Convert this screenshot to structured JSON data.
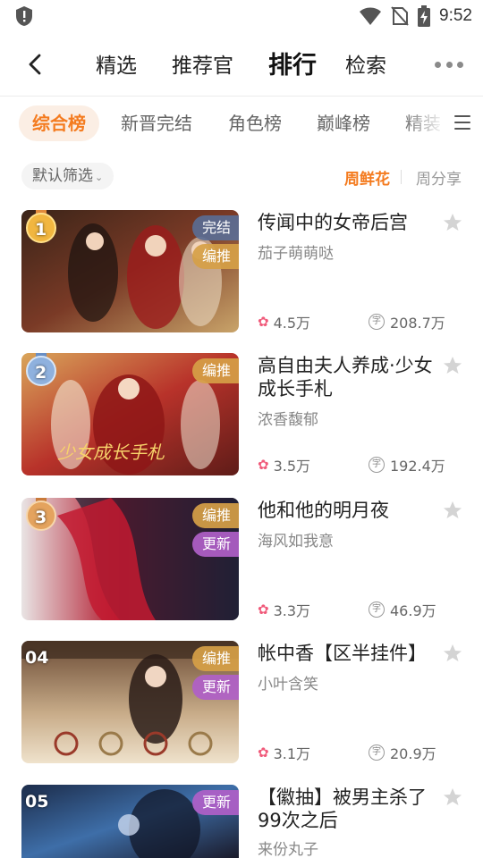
{
  "status_bar": {
    "time": "9:52",
    "icons": [
      "shield-alert-icon",
      "wifi-icon",
      "no-sim-icon",
      "battery-charging-icon"
    ]
  },
  "nav": {
    "tabs": [
      {
        "label": "精选",
        "active": false
      },
      {
        "label": "推荐官",
        "active": false
      },
      {
        "label": "排行",
        "active": true
      },
      {
        "label": "检索",
        "active": false
      }
    ],
    "back_icon": "chevron-left-icon",
    "more_icon": "more-dots-icon"
  },
  "categories": [
    {
      "label": "综合榜",
      "active": true
    },
    {
      "label": "新晋完结",
      "active": false
    },
    {
      "label": "角色榜",
      "active": false
    },
    {
      "label": "巅峰榜",
      "active": false
    },
    {
      "label": "精装",
      "active": false
    }
  ],
  "filter": {
    "label": "默认筛选",
    "sort_active": "周鲜花",
    "sort_other": "周分享"
  },
  "books": [
    {
      "rank": "1",
      "title": "传闻中的女帝后宫",
      "author": "茄子萌萌哒",
      "flowers": "4.5万",
      "words": "208.7万",
      "badges": [
        "完结",
        "编推"
      ]
    },
    {
      "rank": "2",
      "title": "高自由夫人养成·少女成长手札",
      "author": "浓香馥郁",
      "flowers": "3.5万",
      "words": "192.4万",
      "badges": [
        "编推"
      ]
    },
    {
      "rank": "3",
      "title": "他和他的明月夜",
      "author": "海风如我意",
      "flowers": "3.3万",
      "words": "46.9万",
      "badges": [
        "编推",
        "更新"
      ]
    },
    {
      "rank": "04",
      "title": "帐中香【区半挂件】",
      "author": "小叶含笑",
      "flowers": "3.1万",
      "words": "20.9万",
      "badges": [
        "编推",
        "更新"
      ]
    },
    {
      "rank": "05",
      "title": "【徽抽】被男主杀了99次之后",
      "author": "来份丸子",
      "flowers": "",
      "words": "",
      "badges": [
        "更新"
      ]
    }
  ],
  "words_icon_char": "字"
}
